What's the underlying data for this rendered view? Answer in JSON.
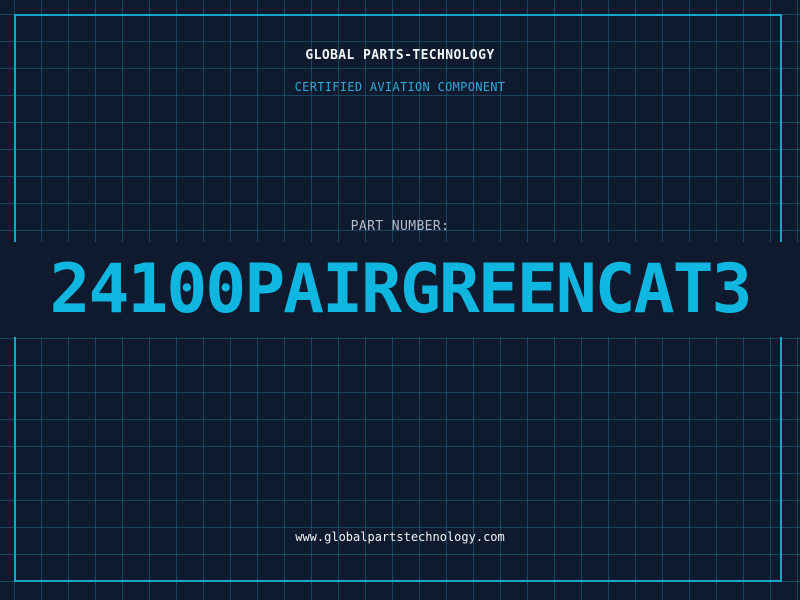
{
  "header": {
    "company": "GLOBAL PARTS-TECHNOLOGY",
    "subtitle": "CERTIFIED AVIATION COMPONENT"
  },
  "part": {
    "label": "PART NUMBER:",
    "number": "24100PAIRGREENCAT3"
  },
  "footer": {
    "website": "www.globalpartstechnology.com"
  },
  "colors": {
    "background": "#101a2e",
    "grid": "#1e82a0",
    "frame": "#12a7c9",
    "accent": "#0fb6e0",
    "text": "#f2f5f8"
  }
}
